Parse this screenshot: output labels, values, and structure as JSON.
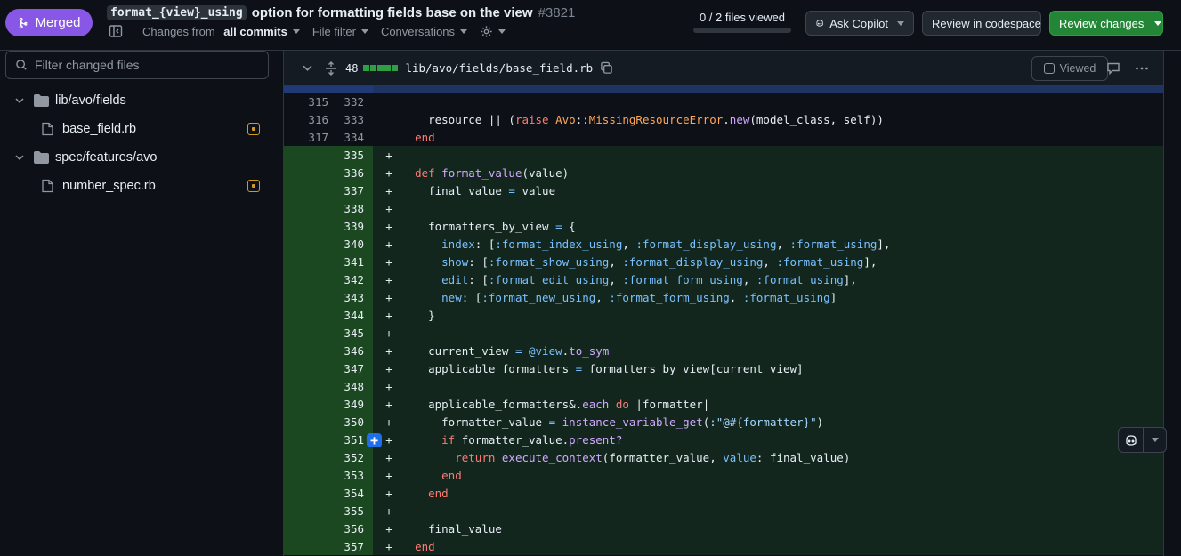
{
  "header": {
    "status_badge": "Merged",
    "title_code": "format_{view}_using",
    "title_text": "option for formatting fields base on the view",
    "pr_number": "#3821",
    "changes_from_prefix": "Changes from",
    "changes_from_value": "all commits",
    "file_filter": "File filter",
    "conversations": "Conversations",
    "files_viewed": "0 / 2 files viewed",
    "ask_copilot": "Ask Copilot",
    "review_codespace": "Review in codespace",
    "review_changes": "Review changes"
  },
  "sidebar": {
    "filter_placeholder": "Filter changed files",
    "tree": [
      {
        "type": "folder",
        "label": "lib/avo/fields"
      },
      {
        "type": "file",
        "label": "base_field.rb",
        "status": "modified"
      },
      {
        "type": "folder",
        "label": "spec/features/avo"
      },
      {
        "type": "file",
        "label": "number_spec.rb",
        "status": "modified"
      }
    ]
  },
  "diff_file": {
    "changes_count": "48",
    "path": "lib/avo/fields/base_field.rb",
    "viewed_label": "Viewed",
    "diffstat": {
      "added": 5,
      "neutral": 0
    }
  },
  "colors": {
    "merged": "#8957e5",
    "added_bg": "#12261e",
    "added_gutter": "#1b4721",
    "green_button": "#238636",
    "modified": "#d29922"
  }
}
